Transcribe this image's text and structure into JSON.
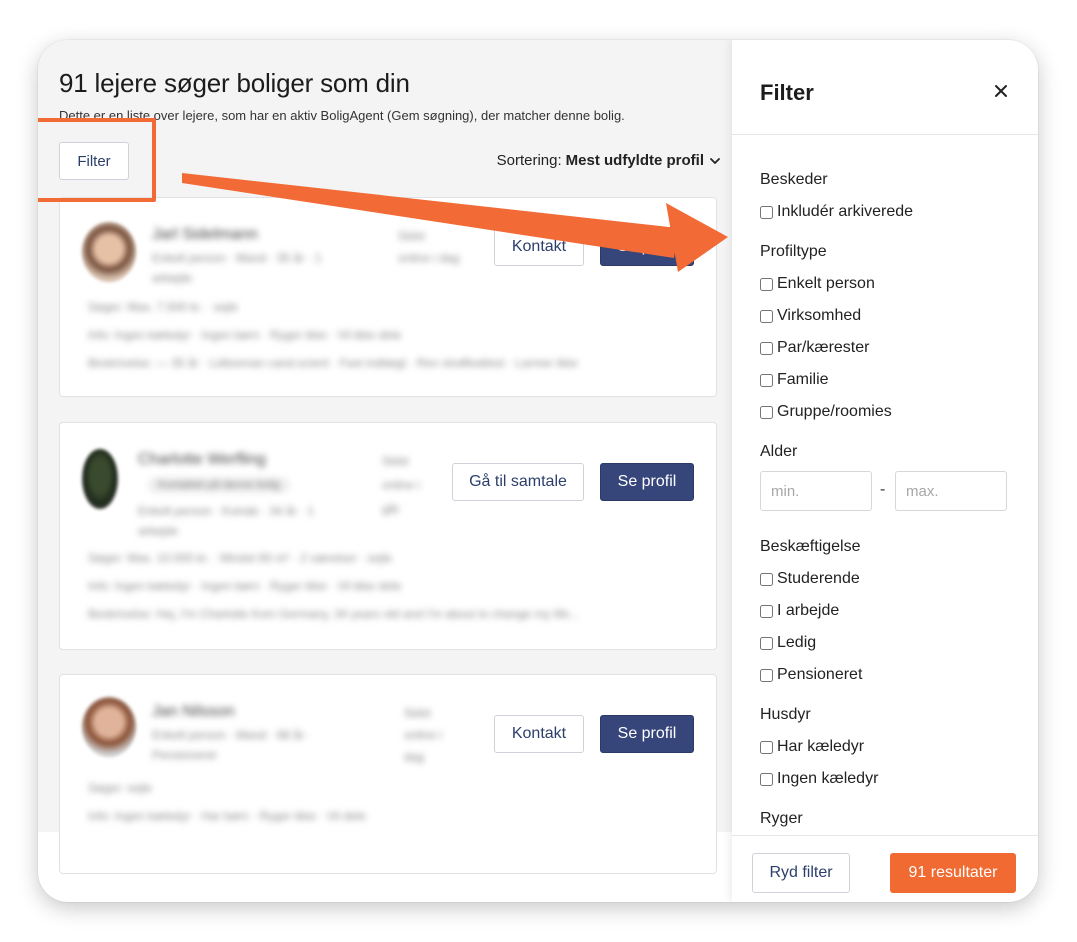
{
  "header": {
    "title": "91 lejere søger boliger som din",
    "subtitle": "Dette er en liste over lejere, som har en aktiv BoligAgent (Gem søgning), der matcher denne bolig."
  },
  "toolbar": {
    "filter_label": "Filter",
    "sort_prefix": "Sortering:",
    "sort_value": "Mest udfyldte profil"
  },
  "cards": [
    {
      "name": "Jarl Sidelmann",
      "meta1": "Enkelt person · Mand · 35 år · 1",
      "meta2": "arbejde",
      "status1": "Sidst",
      "status2": "online i dag",
      "line1": "Søger: Max. 7.500 kr. · sejle",
      "line2": "Info: Ingen kæledyr · Ingen børn · Ryger ikke · Vil ikke dele",
      "line3": "Beskrivelse: — 35 år · Lidtseman cand.scient · Fast indtægt · Ren straffeattest · Larmer ikke",
      "action_label": "Kontakt",
      "profile_label": "Se profil"
    },
    {
      "name": "Charlotte Werfling",
      "tag": "Kontaktet på denne bolig",
      "meta1": "Enkelt person · Kvinde · 34 år · 1",
      "meta2": "arbejde",
      "status1": "Sidst",
      "status2": "online i",
      "status3": "går",
      "line1": "Søger: Max. 10.000 kr. · Mindst 60 m² · 2 værelser · sejle",
      "line2": "Info: Ingen kæledyr · Ingen børn · Ryger ikke · Vil ikke dele",
      "line3": "Beskrivelse: Hej, I'm Charlotte from Germany, 34 years old and I'm about to change my life...",
      "action_label": "Gå til samtale",
      "profile_label": "Se profil"
    },
    {
      "name": "Jan Nilsson",
      "meta1": "Enkelt person · Mand · 68 år ·",
      "meta2": "Pensioneret",
      "status1": "Sidst",
      "status2": "online i",
      "status3": "dag",
      "line1": "Søger: sejle",
      "line2": "Info: Ingen kæledyr · Har børn · Ryger ikke · Vil dele",
      "action_label": "Kontakt",
      "profile_label": "Se profil"
    }
  ],
  "filter_panel": {
    "title": "Filter",
    "sections": {
      "messages": {
        "title": "Beskeder",
        "options": [
          "Inkludér arkiverede"
        ]
      },
      "profile_type": {
        "title": "Profiltype",
        "options": [
          "Enkelt person",
          "Virksomhed",
          "Par/kærester",
          "Familie",
          "Gruppe/roomies"
        ]
      },
      "age": {
        "title": "Alder",
        "min_placeholder": "min.",
        "max_placeholder": "max.",
        "separator": "-"
      },
      "employment": {
        "title": "Beskæftigelse",
        "options": [
          "Studerende",
          "I arbejde",
          "Ledig",
          "Pensioneret"
        ]
      },
      "pets": {
        "title": "Husdyr",
        "options": [
          "Har kæledyr",
          "Ingen kæledyr"
        ]
      },
      "smoker": {
        "title": "Ryger"
      }
    },
    "reset_label": "Ryd filter",
    "results_label": "91 resultater"
  },
  "colors": {
    "primary": "#36467a",
    "accent": "#f06a31",
    "annotation": "#f26a35",
    "background": "#f4f4f5"
  }
}
